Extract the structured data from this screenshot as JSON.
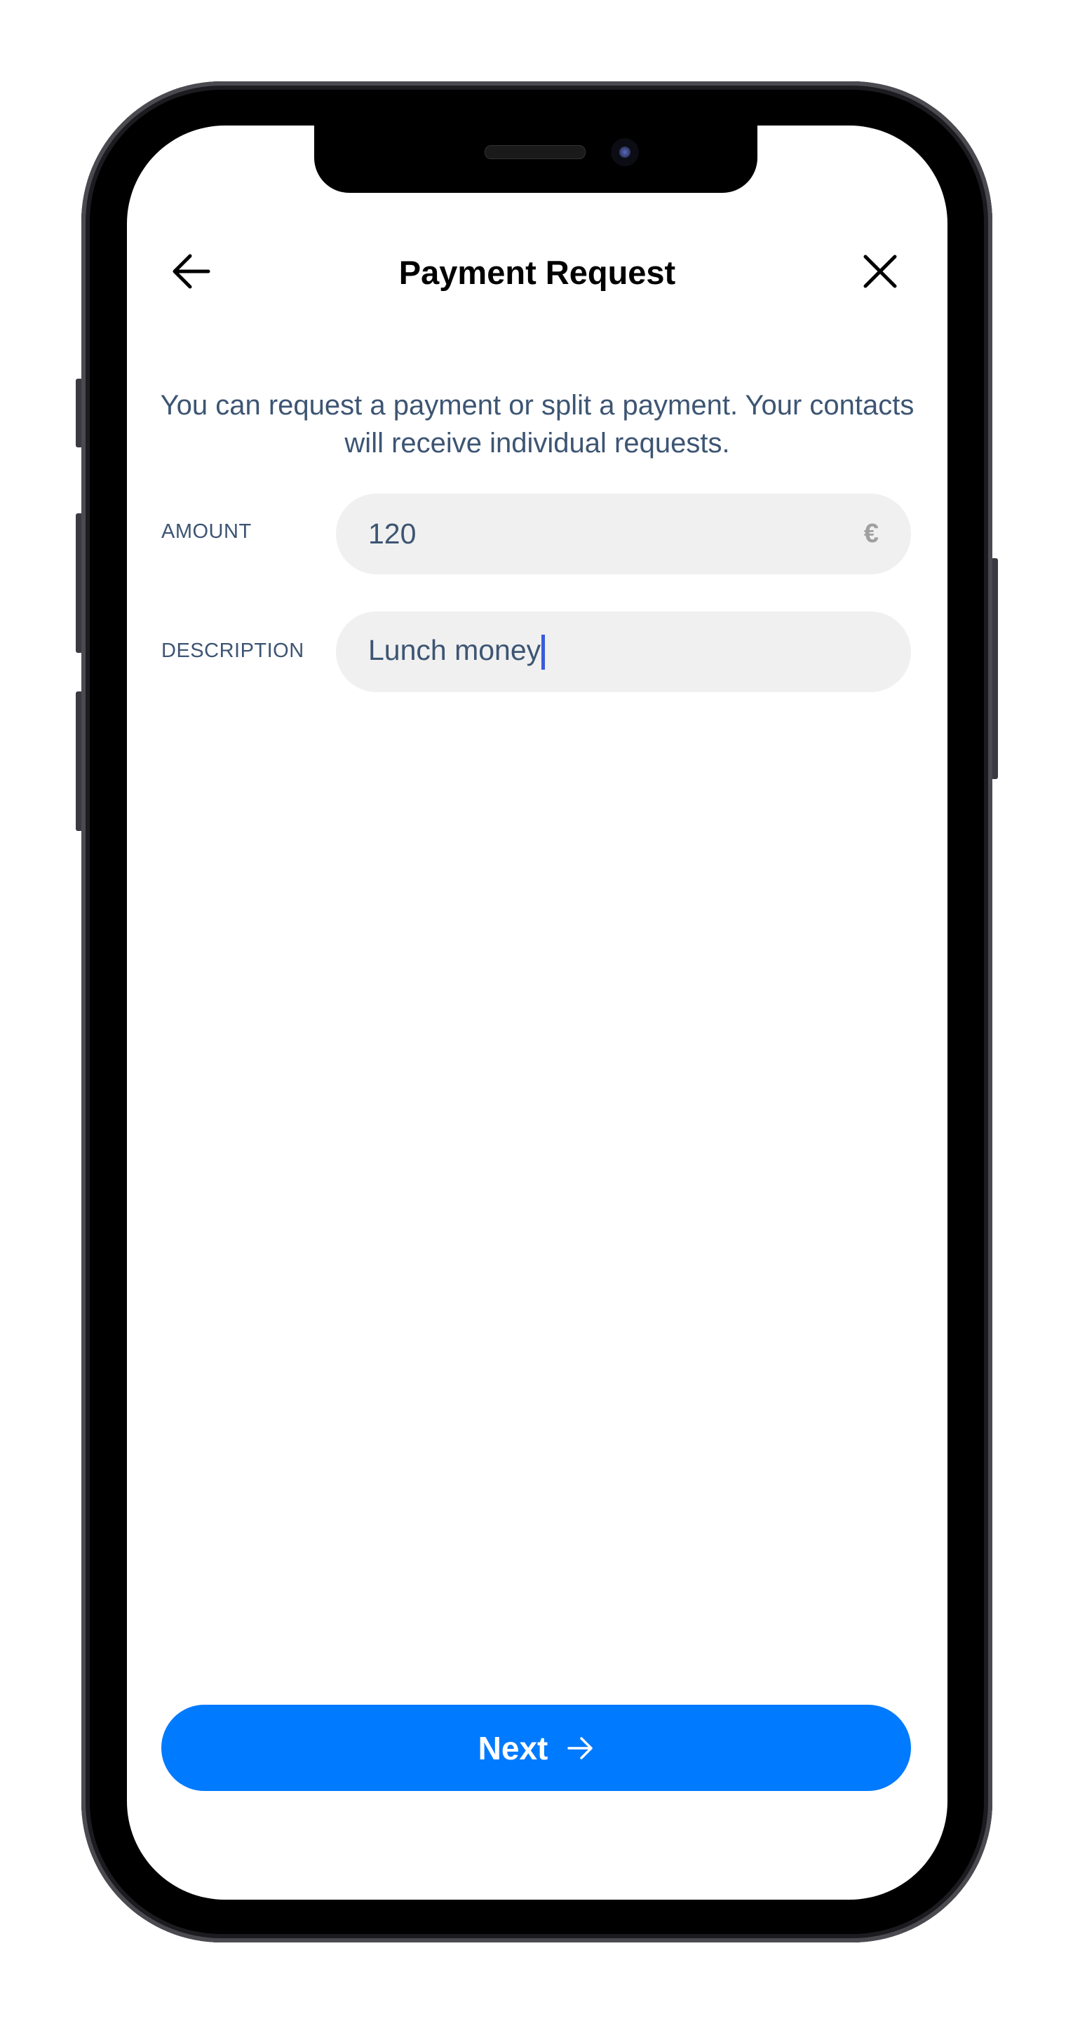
{
  "header": {
    "title": "Payment Request",
    "back_icon": "arrow-left",
    "close_icon": "x"
  },
  "intro": "You can request a payment or split a payment. Your contacts will receive individual requests.",
  "form": {
    "amount": {
      "label": "AMOUNT",
      "value": "120",
      "currency": "€"
    },
    "description": {
      "label": "DESCRIPTION",
      "value": "Lunch money"
    }
  },
  "next_button": {
    "label": "Next",
    "icon": "arrow-right",
    "color": "#007aff"
  }
}
